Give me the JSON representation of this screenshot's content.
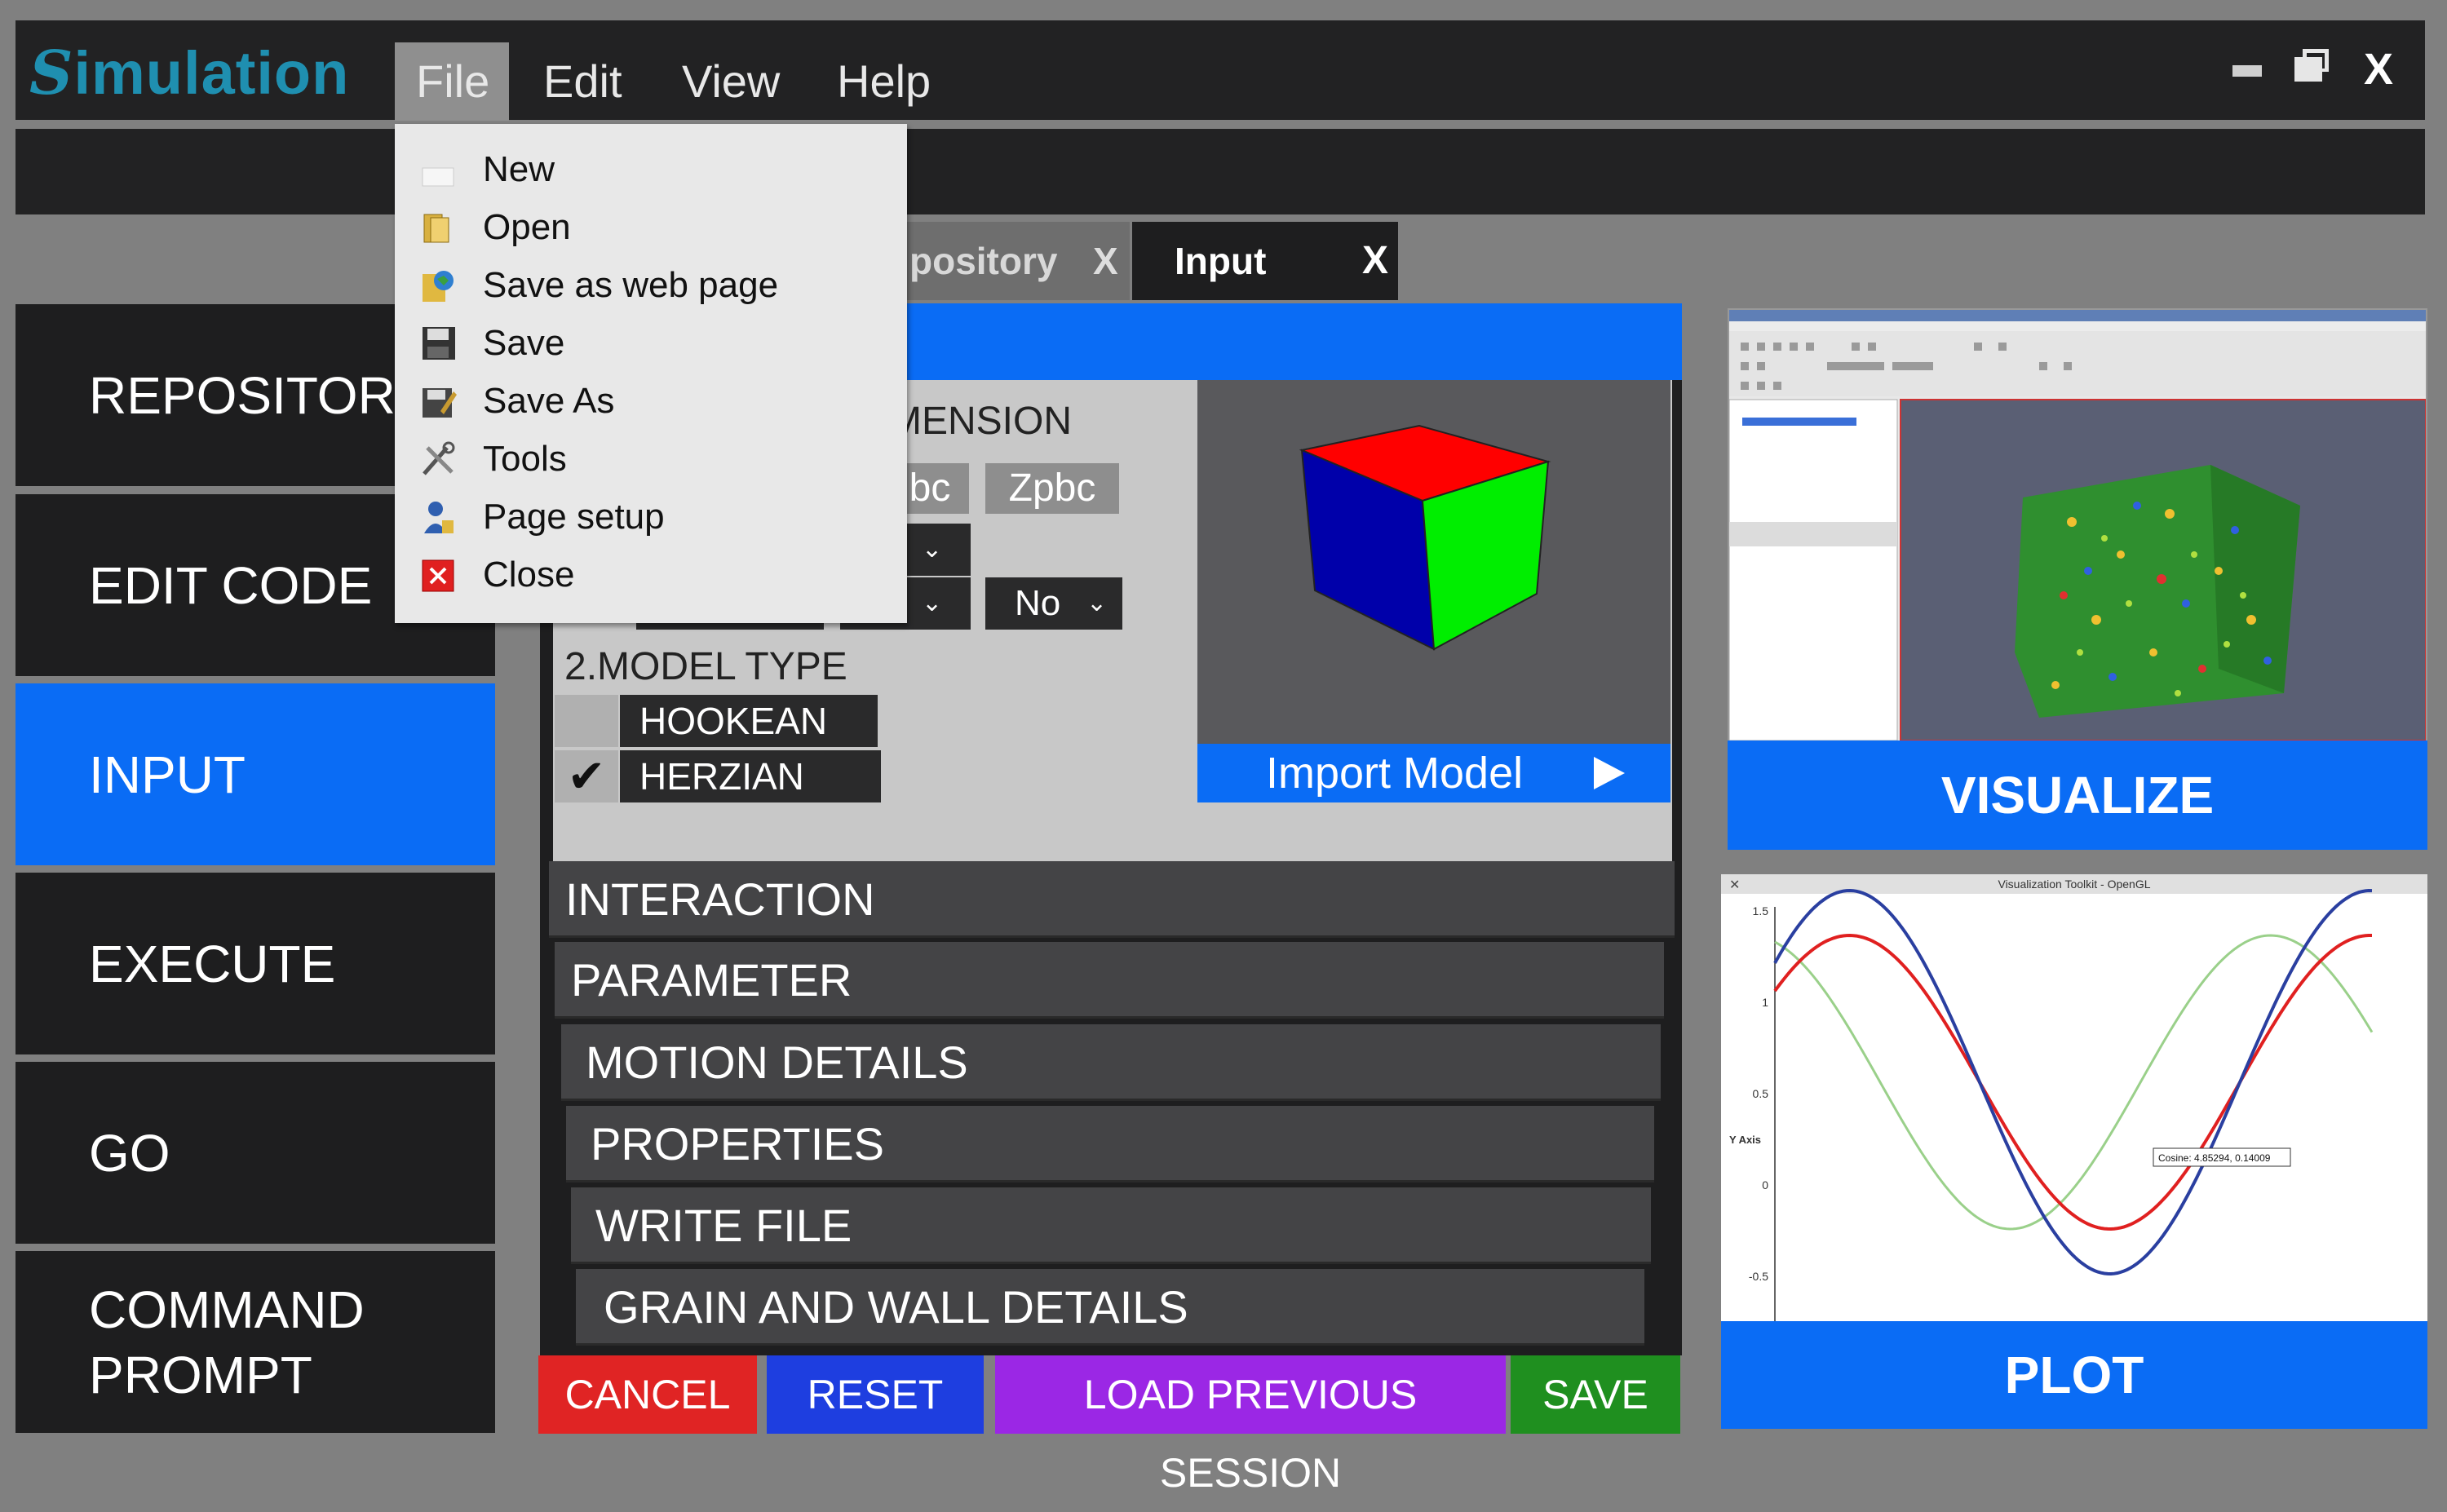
{
  "app": {
    "logo_first": "S",
    "logo_rest": "imulation"
  },
  "menubar": {
    "file": "File",
    "edit": "Edit",
    "view": "View",
    "help": "Help"
  },
  "window_controls": {
    "close": "X"
  },
  "file_menu": [
    {
      "label": "New",
      "icon": "new-file-icon"
    },
    {
      "label": "Open",
      "icon": "folder-icon"
    },
    {
      "label": "Save as web page",
      "icon": "web-page-icon"
    },
    {
      "label": "Save",
      "icon": "floppy-icon"
    },
    {
      "label": "Save As",
      "icon": "save-as-icon"
    },
    {
      "label": "Tools",
      "icon": "tools-icon"
    },
    {
      "label": "Page setup",
      "icon": "page-setup-icon"
    },
    {
      "label": "Close",
      "icon": "close-icon"
    }
  ],
  "sidebar": {
    "items": [
      {
        "label": "REPOSITORY"
      },
      {
        "label": "EDIT CODE"
      },
      {
        "label": "INPUT",
        "active": true
      },
      {
        "label": "EXECUTE"
      },
      {
        "label": "GO"
      },
      {
        "label": "COMMAND PROMPT"
      }
    ]
  },
  "tabs": {
    "repository": "pository",
    "repository_close": "X",
    "input": "Input",
    "input_close": "X"
  },
  "input_panel": {
    "dimension_label": "MENSION",
    "ypbc_chip": "bc",
    "zpbc_chip": "Zpbc",
    "dropdown_no": "No",
    "model_type_label": "2.MODEL TYPE",
    "model_types": [
      {
        "label": "HOOKEAN",
        "checked": false
      },
      {
        "label": "HERZIAN",
        "checked": true
      }
    ],
    "import_model": "Import Model"
  },
  "accordion": {
    "interaction": "INTERACTION",
    "parameter": "PARAMETER",
    "motion_details": "MOTION DETAILS",
    "properties": "PROPERTIES",
    "write_file": "WRITE FILE",
    "grain_wall": "GRAIN AND WALL DETAILS"
  },
  "actions": {
    "cancel": "CANCEL",
    "reset": "RESET",
    "load_previous": "LOAD PREVIOUS SESSION",
    "save": "SAVE"
  },
  "previews": {
    "visualize": "VISUALIZE",
    "plot": "PLOT",
    "plot_window_title": "Visualization Toolkit - OpenGL",
    "plot_tooltip": "Cosine: 4.85294, 0.14009",
    "plot_ylabel": "Y Axis",
    "plot_ticks": [
      "1.5",
      "1",
      "0.5",
      "0",
      "-0.5"
    ]
  },
  "colors": {
    "accent": "#0a6cf5",
    "cancel": "#e02424",
    "reset": "#1e3ee0",
    "load": "#9b27e5",
    "save": "#1f8f1f",
    "logo": "#1f8fb0"
  }
}
